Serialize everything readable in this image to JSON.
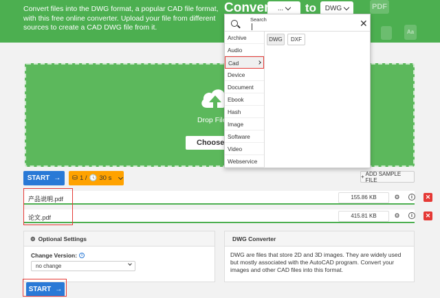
{
  "header": {
    "description": "Convert files into the DWG format, a popular CAD file format, with this free online converter. Upload your file from different sources to create a CAD DWG file from it.",
    "convert_label": "Convert",
    "from_value": "...",
    "to_label": "to",
    "to_value": "DWG",
    "deco_pdf": "PDF",
    "deco_small": "Aa"
  },
  "drop_zone": {
    "text": "Drop Files",
    "choose_label": "Choose F"
  },
  "toolbar": {
    "start_label": "START",
    "limit_files": "1 /",
    "limit_time": "30 s",
    "sample_label": "ADD SAMPLE FILE"
  },
  "files": [
    {
      "name": "产品说明.pdf",
      "size": "155.86 KB"
    },
    {
      "name": "论文.pdf",
      "size": "415.81 KB"
    }
  ],
  "optional_settings": {
    "title": "Optional Settings",
    "change_version_label": "Change Version:",
    "version_value": "no change"
  },
  "converter_info": {
    "title": "DWG Converter",
    "text": "DWG are files that store 2D and 3D images. They are widely used but mostly associated with the AutoCAD program. Convert your images and other CAD files into this format."
  },
  "dropdown": {
    "search_label": "Search",
    "categories": [
      "Archive",
      "Audio",
      "Cad",
      "Device",
      "Document",
      "Ebook",
      "Hash",
      "Image",
      "Software",
      "Video",
      "Webservice"
    ],
    "active_category": "Cad",
    "formats": [
      "DWG",
      "DXF"
    ]
  },
  "colors": {
    "brand_green": "#4caf50",
    "drop_green": "#5cb85c",
    "start_blue": "#2979d6",
    "limit_orange": "#ffa200",
    "annotation_red": "#e53935"
  }
}
